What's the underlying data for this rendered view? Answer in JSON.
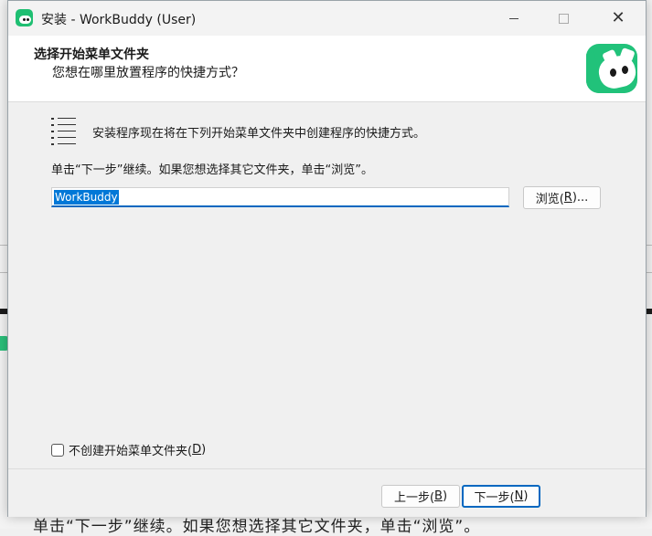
{
  "window": {
    "title": "安装 - WorkBuddy (User)",
    "close_glyph": "✕"
  },
  "header": {
    "title": "选择开始菜单文件夹",
    "subtitle": "您想在哪里放置程序的快捷方式？"
  },
  "main": {
    "description": "安装程序现在将在下列开始菜单文件夹中创建程序的快捷方式。",
    "instruction": "单击“下一步”继续。如果您想选择其它文件夹，单击“浏览”。",
    "folder_value": "WorkBuddy",
    "browse_label_pre": "浏览(",
    "browse_key": "R",
    "browse_label_post": ")...",
    "no_folder_label_pre": "不创建开始菜单文件夹(",
    "no_folder_key": "D",
    "no_folder_label_post": ")",
    "no_folder_checked": false
  },
  "footer": {
    "back_pre": "上一步(",
    "back_key": "B",
    "back_post": ")",
    "next_pre": "下一步(",
    "next_key": "N",
    "next_post": ")"
  },
  "background": {
    "partial_text": "单击“下一步”继续。如果您想选择其它文件夹，单击“浏览”。"
  },
  "colors": {
    "accent": "#0067c0",
    "brand": "#21c27a",
    "selection": "#0078d7"
  },
  "icons": [
    "workbuddy-app-icon",
    "minimize-icon",
    "maximize-icon",
    "close-icon",
    "workbuddy-logo",
    "list-icon",
    "checkbox-icon"
  ]
}
